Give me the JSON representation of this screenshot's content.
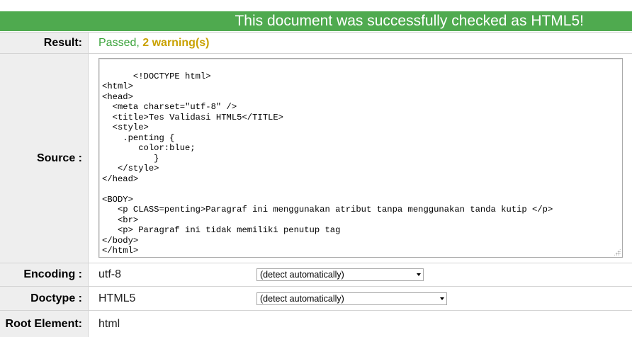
{
  "banner": {
    "message": "This document was successfully checked as HTML5!"
  },
  "result": {
    "label": "Result:",
    "status": "Passed",
    "separator": ", ",
    "warnings": "2 warning(s)"
  },
  "source": {
    "label": "Source :",
    "code": "<!DOCTYPE html>\n<html>\n<head>\n  <meta charset=\"utf-8\" />\n  <title>Tes Validasi HTML5</TITLE>\n  <style>\n    .penting {\n       color:blue;\n          }\n   </style>\n</head>\n\n<BODY>\n   <p CLASS=penting>Paragraf ini menggunakan atribut tanpa menggunakan tanda kutip </p>\n   <br>\n   <p> Paragraf ini tidak memiliki penutup tag\n</body>\n</html>"
  },
  "encoding": {
    "label": "Encoding :",
    "value": "utf-8",
    "select_value": "(detect automatically)"
  },
  "doctype": {
    "label": "Doctype :",
    "value": "HTML5",
    "select_value": "(detect automatically)"
  },
  "root_element": {
    "label": "Root Element:",
    "value": "html"
  },
  "colors": {
    "banner_bg": "#4faa4f",
    "passed": "#3aa23a",
    "warning": "#c9a100",
    "label_bg": "#eeeeee"
  }
}
